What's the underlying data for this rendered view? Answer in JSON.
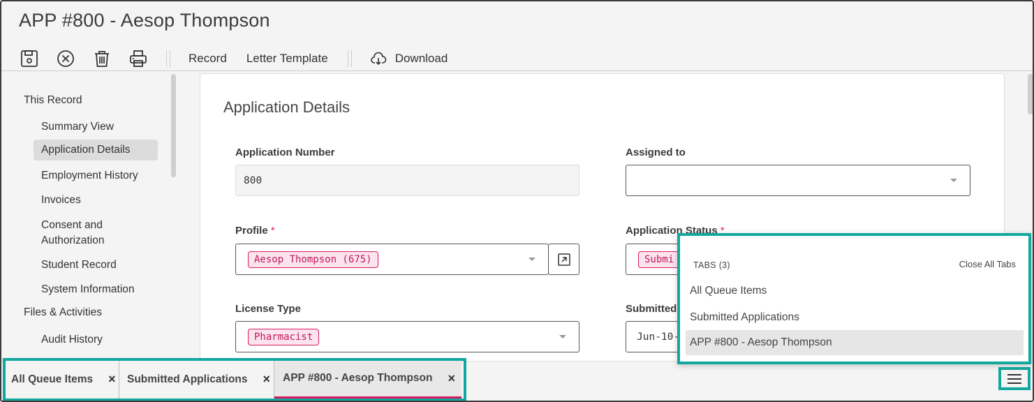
{
  "window": {
    "title": "APP #800 - Aesop Thompson"
  },
  "toolbar": {
    "icons": [
      "save-icon",
      "cancel-icon",
      "delete-icon",
      "print-icon"
    ],
    "record_label": "Record",
    "letter_template_label": "Letter Template",
    "download_label": "Download"
  },
  "sidebar": {
    "section_this_record": "This Record",
    "items": [
      {
        "label": "Summary View"
      },
      {
        "label": "Application Details"
      },
      {
        "label": "Employment History"
      },
      {
        "label": "Invoices"
      },
      {
        "label": "Consent and Authorization"
      },
      {
        "label": "Student Record"
      },
      {
        "label": "System Information"
      }
    ],
    "section_files": "Files & Activities",
    "files_items": [
      {
        "label": "Audit History"
      }
    ]
  },
  "form": {
    "title": "Application Details",
    "application_number": {
      "label": "Application Number",
      "value": "800"
    },
    "assigned_to": {
      "label": "Assigned to",
      "value": ""
    },
    "profile": {
      "label": "Profile",
      "required_mark": "*",
      "value": "Aesop Thompson (675)"
    },
    "application_status": {
      "label": "Application Status",
      "required_mark": "*",
      "value_partial": "Submi"
    },
    "license_type": {
      "label": "License Type",
      "value": "Pharmacist"
    },
    "submitted": {
      "label_partial": "Submitted",
      "value_partial": "Jun-10-"
    }
  },
  "tabs_menu": {
    "header": "TABS (3)",
    "close_all": "Close All Tabs",
    "items": [
      {
        "label": "All Queue Items"
      },
      {
        "label": "Submitted Applications"
      },
      {
        "label": "APP #800 - Aesop Thompson"
      }
    ]
  },
  "bottom_tabs": [
    {
      "label": "All Queue Items",
      "close": "×"
    },
    {
      "label": "Submitted Applications",
      "close": "×"
    },
    {
      "label": "APP #800 - Aesop Thompson",
      "close": "×"
    }
  ],
  "colors": {
    "accent": "#d81b60",
    "highlight": "#13a89e"
  }
}
